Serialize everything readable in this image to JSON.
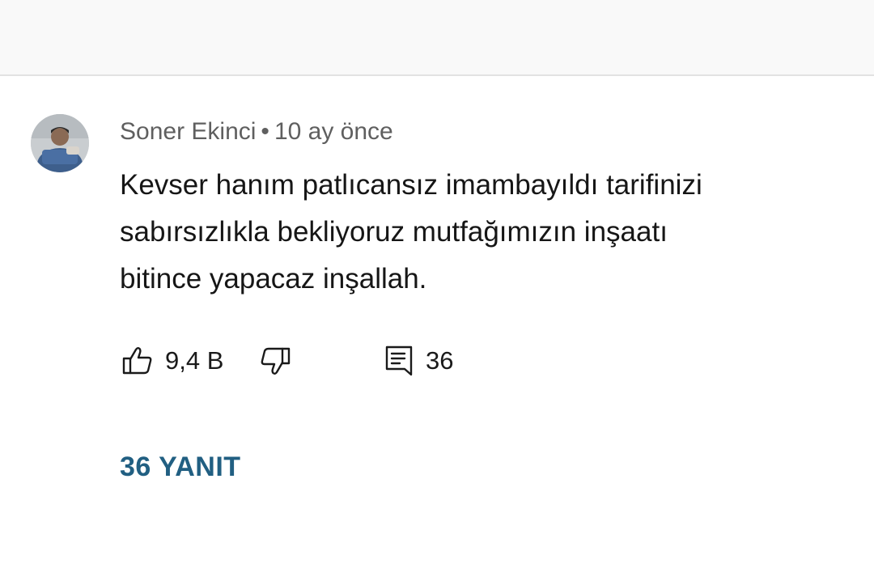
{
  "comment": {
    "author": "Soner Ekinci",
    "separator": "•",
    "time": "10 ay önce",
    "text_lines": [
      "Kevser hanım patlıcansız imambayıldı tarifinizi",
      "sabırsızlıkla bekliyoruz mutfağımızın inşaatı",
      "bitince yapacaz inşallah."
    ],
    "like_count": "9,4 B",
    "reply_count": "36",
    "replies_label": "36 YANIT"
  },
  "icons": {
    "like": "thumbs-up-icon",
    "dislike": "thumbs-down-icon",
    "reply": "comment-icon"
  },
  "colors": {
    "meta_text": "#5f5f5f",
    "body_text": "#161616",
    "replies_link": "#215f82"
  }
}
